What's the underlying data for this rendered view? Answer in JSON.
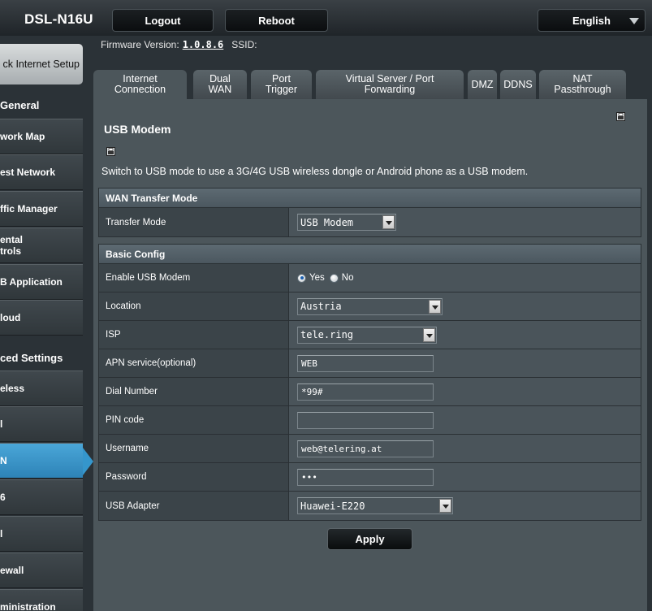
{
  "header": {
    "brand": "DSL-N16U",
    "logout_label": "Logout",
    "reboot_label": "Reboot",
    "language": "English",
    "firmware_label": "Firmware Version:",
    "firmware_version": "1.0.8.6",
    "ssid_label": "SSID:"
  },
  "sidebar": {
    "quick_setup": "ck Internet Setup",
    "general_heading": "General",
    "general_items": [
      {
        "label": "work Map"
      },
      {
        "label": "est Network"
      },
      {
        "label": "ffic Manager"
      },
      {
        "label": "ental\ntrols"
      },
      {
        "label": "B Application"
      },
      {
        "label": "loud"
      }
    ],
    "advanced_heading": "ced Settings",
    "advanced_items": [
      {
        "label": "eless"
      },
      {
        "label": "l"
      },
      {
        "label": "N"
      },
      {
        "label": "6"
      },
      {
        "label": "l"
      },
      {
        "label": "ewall"
      },
      {
        "label": "ministration"
      }
    ]
  },
  "tabs": [
    {
      "label": "Internet\nConnection"
    },
    {
      "label": "Dual\nWAN"
    },
    {
      "label": "Port\nTrigger"
    },
    {
      "label": "Virtual Server / Port\nForwarding"
    },
    {
      "label": "DMZ"
    },
    {
      "label": "DDNS"
    },
    {
      "label": "NAT\nPassthrough"
    }
  ],
  "main": {
    "title": "USB Modem",
    "description": "Switch to USB mode to use a 3G/4G USB wireless dongle or Android phone as a USB modem.",
    "wan_section": {
      "heading": "WAN Transfer Mode",
      "transfer_mode_label": "Transfer Mode",
      "transfer_mode_value": "USB Modem"
    },
    "basic_section": {
      "heading": "Basic Config",
      "enable_label": "Enable USB Modem",
      "yes_label": "Yes",
      "no_label": "No",
      "location_label": "Location",
      "location_value": "Austria",
      "isp_label": "ISP",
      "isp_value": "tele.ring",
      "apn_label": "APN service(optional)",
      "apn_value": "WEB",
      "dial_label": "Dial Number",
      "dial_value": "*99#",
      "pin_label": "PIN code",
      "pin_value": "",
      "username_label": "Username",
      "username_value": "web@telering.at",
      "password_label": "Password",
      "password_value": "•••",
      "adapter_label": "USB Adapter",
      "adapter_value": "Huawei-E220"
    },
    "apply_label": "Apply"
  }
}
